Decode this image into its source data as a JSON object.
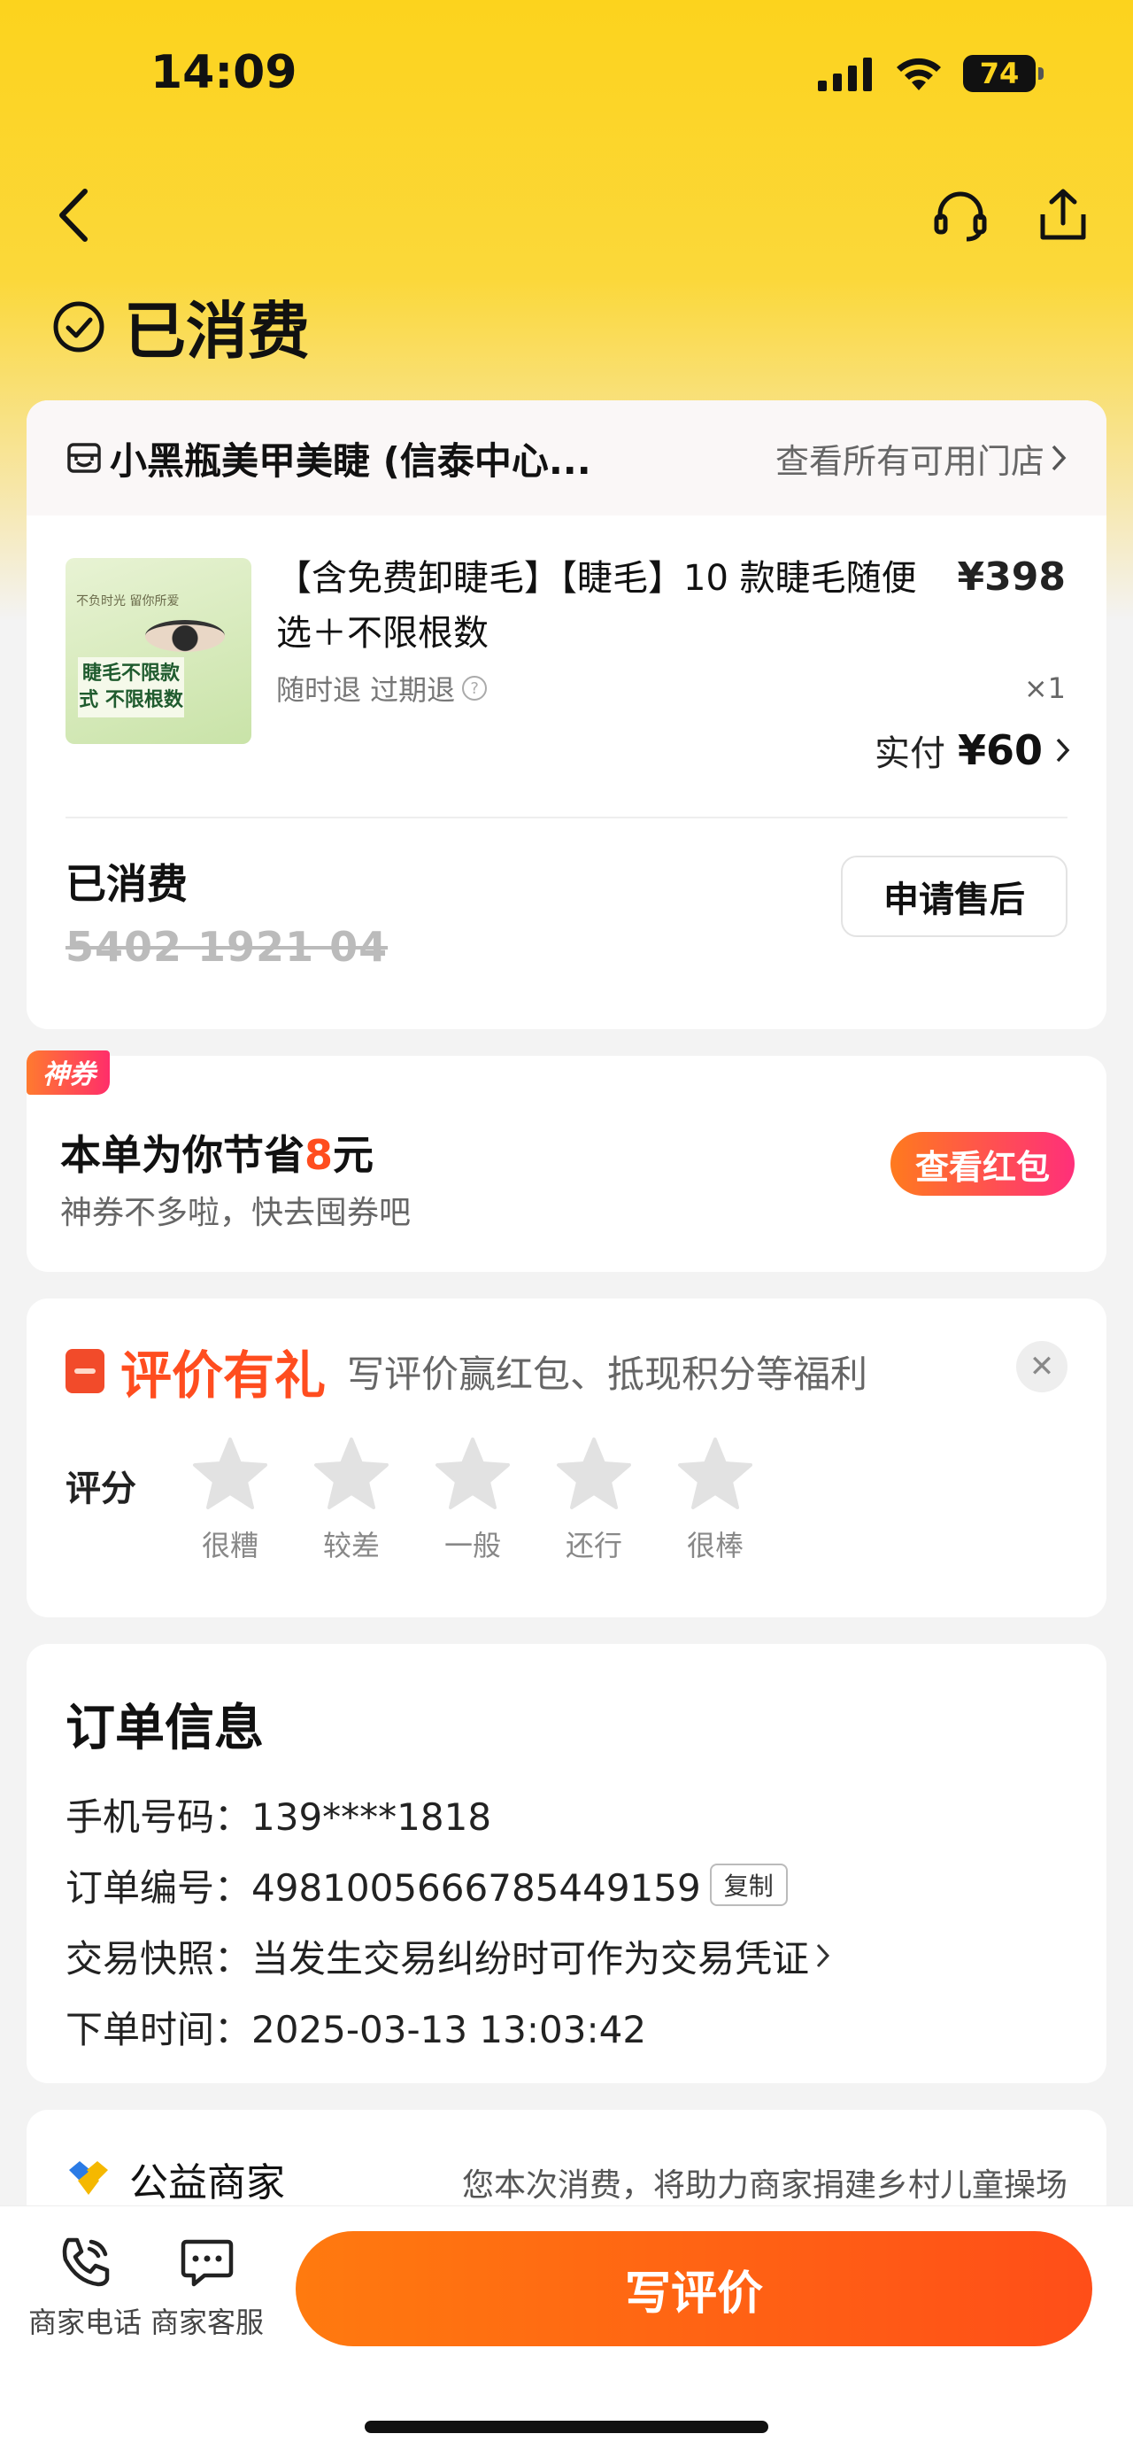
{
  "status_bar": {
    "time": "14:09",
    "battery": "74"
  },
  "header": {
    "title": "已消费"
  },
  "shop": {
    "name": "小黑瓶美甲美睫 (信泰中心...",
    "link_label": "查看所有可用门店"
  },
  "product": {
    "title": "【含免费卸睫毛】【睫毛】10 款睫毛随便选＋不限根数",
    "price": "¥398",
    "tags": "随时退 过期退",
    "qty": "×1",
    "paid_label": "实付",
    "paid_amount": "¥60",
    "image_caption": "睫毛不限款式 不限根数",
    "image_small_text": "不负时光 留你所爱"
  },
  "consume": {
    "status": "已消费",
    "code": "5402 1921 04",
    "after_sale_label": "申请售后"
  },
  "coupon": {
    "tag": "神券",
    "title_prefix": "本单为你节省",
    "saved_amount": "8",
    "title_suffix": "元",
    "subtitle": "神券不多啦，快去囤券吧",
    "button_label": "查看红包"
  },
  "review": {
    "title": "评价有礼",
    "subtitle": "写评价赢红包、抵现积分等福利",
    "rating_label": "评分",
    "stars": [
      {
        "label": "很糟"
      },
      {
        "label": "较差"
      },
      {
        "label": "一般"
      },
      {
        "label": "还行"
      },
      {
        "label": "很棒"
      }
    ]
  },
  "order_info": {
    "title": "订单信息",
    "phone": "手机号码：139****1818",
    "order_no": "订单编号：4981005666785449159",
    "copy_label": "复制",
    "snapshot": "交易快照：当发生交易纠纷时可作为交易凭证",
    "time": "下单时间：2025-03-13 13:03:42"
  },
  "charity": {
    "name": "公益商家",
    "desc": "您本次消费，将助力商家捐建乡村儿童操场"
  },
  "bottom_bar": {
    "phone_label": "商家电话",
    "service_label": "商家客服",
    "review_button": "写评价"
  },
  "colors": {
    "accent_yellow": "#fcd31d",
    "accent_orange": "#ff4d1f"
  }
}
